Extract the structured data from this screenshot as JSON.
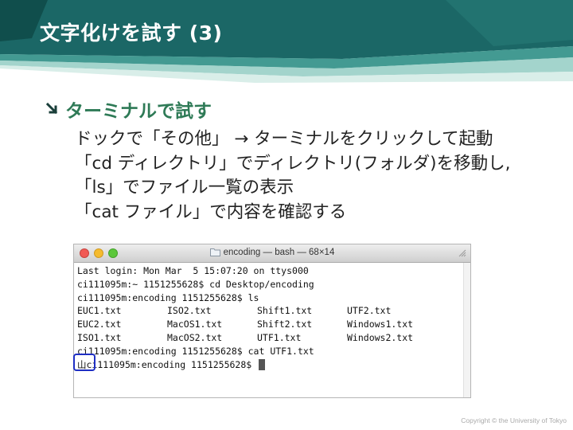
{
  "slide": {
    "title": "文字化けを試す (3)",
    "bullet_heading": "ターミナルで試す",
    "body_lines": [
      "ドックで「その他」 → ターミナルをクリックして起動",
      "「cd ディレクトリ」でディレクトリ(フォルダ)を移動し,",
      "「ls」でファイル一覧の表示",
      "「cat ファイル」で内容を確認する"
    ],
    "copyright": "Copyright © the University of Tokyo"
  },
  "terminal": {
    "window_title": "encoding — bash — 68×14",
    "lines": [
      "Last login: Mon Mar  5 15:07:20 on ttys000",
      "ci111095m:~ 1151255628$ cd Desktop/encoding",
      "ci111095m:encoding 1151255628$ ls"
    ],
    "ls_rows": [
      [
        "EUC1.txt",
        "ISO2.txt",
        "Shift1.txt",
        "UTF2.txt"
      ],
      [
        "EUC2.txt",
        "MacOS1.txt",
        "Shift2.txt",
        "Windows1.txt"
      ],
      [
        "ISO1.txt",
        "MacOS2.txt",
        "UTF1.txt",
        "Windows2.txt"
      ]
    ],
    "cat_line": "ci111095m:encoding 1151255628$ cat UTF1.txt",
    "output_char": "山",
    "last_prompt": "ci111095m:encoding 1151255628$ "
  },
  "colors": {
    "header_teal": "#1f6f6a",
    "heading_green": "#2e7a56",
    "highlight_box": "#1f2fc4"
  },
  "icons": [
    "bullet-arrow-icon",
    "folder-icon",
    "resize-icon"
  ]
}
